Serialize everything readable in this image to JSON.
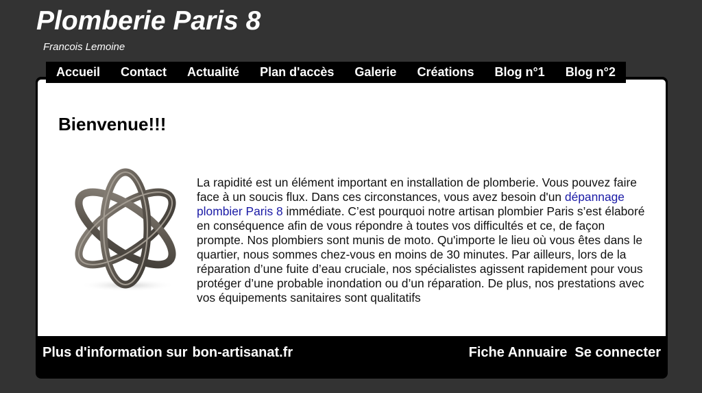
{
  "header": {
    "title": "Plomberie Paris 8",
    "subtitle": "Francois Lemoine"
  },
  "nav": {
    "items": [
      {
        "label": "Accueil"
      },
      {
        "label": "Contact"
      },
      {
        "label": "Actualité"
      },
      {
        "label": "Plan d'accès"
      },
      {
        "label": "Galerie"
      },
      {
        "label": "Créations"
      },
      {
        "label": "Blog n°1"
      },
      {
        "label": "Blog n°2"
      }
    ]
  },
  "main": {
    "heading": "Bienvenue!!!",
    "image_name": "knot-sculpture-image",
    "paragraph_before": "La rapidité est un élément important en installation de plomberie. Vous pouvez faire face à un soucis flux. Dans ces circonstances, vous avez besoin d'un ",
    "paragraph_link": "dépannage plombier Paris 8",
    "paragraph_after": " immédiate. C’est pourquoi notre artisan plombier Paris s’est élaboré en conséquence afin de vous répondre à toutes vos difficultés et ce, de façon prompte. Nos plombiers sont munis de moto. Qu'importe le lieu où vous êtes dans le quartier, nous sommes chez-vous en moins de 30 minutes. Par ailleurs, lors de la réparation d’une fuite d’eau cruciale, nos spécialistes agissent rapidement pour vous protéger d’une probable inondation ou d’un réparation. De plus, nos prestations avec vos équipements sanitaires sont qualitatifs"
  },
  "footer": {
    "info_prefix": "Plus d'information sur",
    "info_link": "bon-artisanat.fr",
    "annuaire": "Fiche Annuaire",
    "login": "Se connecter"
  },
  "colors": {
    "background": "#333333",
    "panel": "#000000",
    "content": "#ffffff",
    "link": "#1a1aa6"
  }
}
